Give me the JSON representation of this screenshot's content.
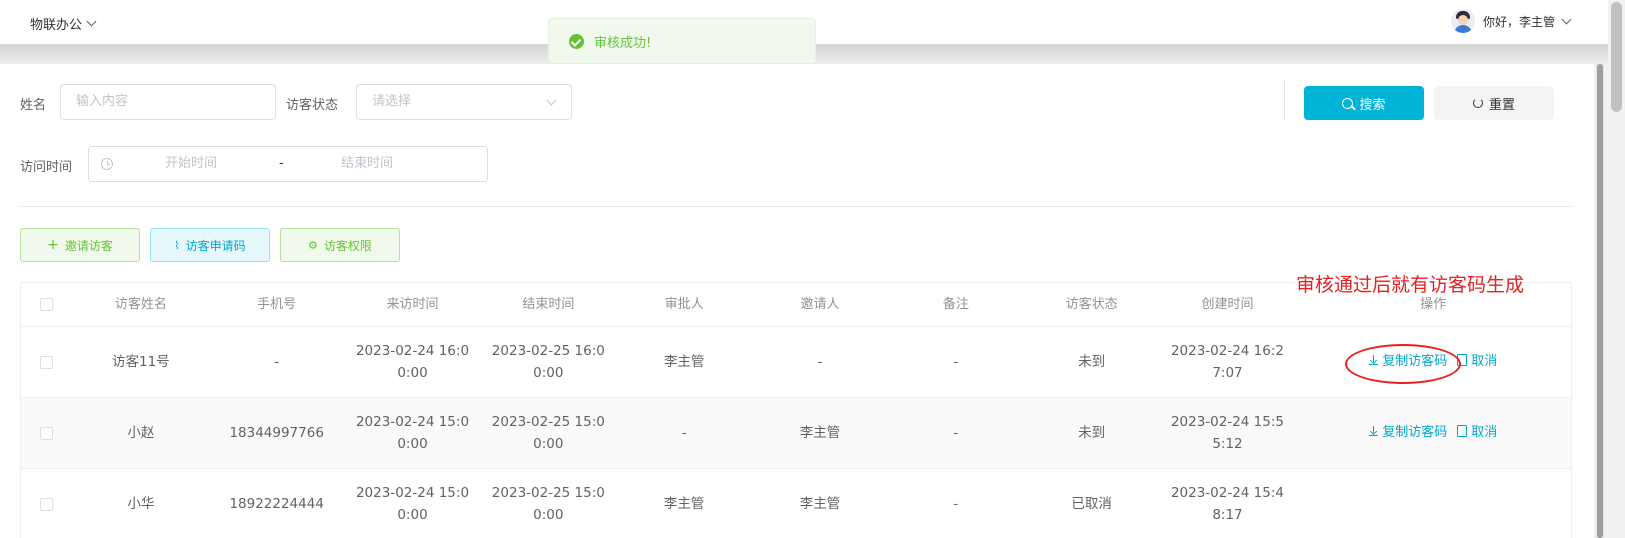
{
  "header": {
    "app_name": "物联办公",
    "greeting": "你好，李主管"
  },
  "toast": {
    "message": "审核成功!"
  },
  "filters": {
    "name_label": "姓名",
    "name_placeholder": "输入内容",
    "status_label": "访客状态",
    "status_placeholder": "请选择",
    "time_label": "访问时间",
    "start_placeholder": "开始时间",
    "range_sep": "-",
    "end_placeholder": "结束时间",
    "search_label": "搜索",
    "reset_label": "重置"
  },
  "actions": {
    "invite": "邀请访客",
    "apply_code": "访客申请码",
    "permission": "访客权限"
  },
  "table": {
    "columns": [
      "访客姓名",
      "手机号",
      "来访时间",
      "结束时间",
      "审批人",
      "邀请人",
      "备注",
      "访客状态",
      "创建时间",
      "操作"
    ],
    "rows": [
      {
        "name": "访客11号",
        "phone": "-",
        "visit_time": [
          "2023-02-24 16:0",
          "0:00"
        ],
        "end_time": [
          "2023-02-25 16:0",
          "0:00"
        ],
        "approver": "李主管",
        "inviter": "-",
        "remark": "-",
        "status": "未到",
        "created": [
          "2023-02-24 16:2",
          "7:07"
        ],
        "ops": [
          "复制访客码",
          "取消"
        ]
      },
      {
        "name": "小赵",
        "phone": "18344997766",
        "visit_time": [
          "2023-02-24 15:0",
          "0:00"
        ],
        "end_time": [
          "2023-02-25 15:0",
          "0:00"
        ],
        "approver": "-",
        "inviter": "李主管",
        "remark": "-",
        "status": "未到",
        "created": [
          "2023-02-24 15:5",
          "5:12"
        ],
        "ops": [
          "复制访客码",
          "取消"
        ]
      },
      {
        "name": "小华",
        "phone": "18922224444",
        "visit_time": [
          "2023-02-24 15:0",
          "0:00"
        ],
        "end_time": [
          "2023-02-25 15:0",
          "0:00"
        ],
        "approver": "李主管",
        "inviter": "李主管",
        "remark": "-",
        "status": "已取消",
        "created": [
          "2023-02-24 15:4",
          "8:17"
        ],
        "ops": []
      }
    ]
  },
  "annotation": {
    "text": "审核通过后就有访客码生成"
  },
  "colors": {
    "primary": "#00b4d8",
    "success": "#67c23a",
    "annotation": "#e82020"
  }
}
